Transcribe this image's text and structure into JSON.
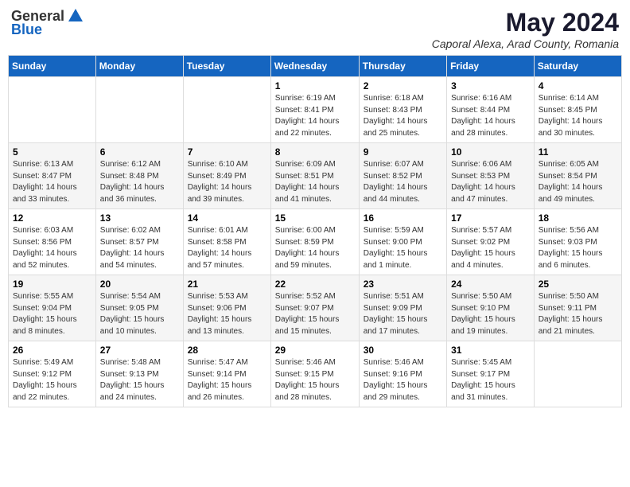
{
  "header": {
    "logo_line1": "General",
    "logo_line2": "Blue",
    "month_title": "May 2024",
    "location": "Caporal Alexa, Arad County, Romania"
  },
  "days_of_week": [
    "Sunday",
    "Monday",
    "Tuesday",
    "Wednesday",
    "Thursday",
    "Friday",
    "Saturday"
  ],
  "weeks": [
    [
      {
        "day": "",
        "info": ""
      },
      {
        "day": "",
        "info": ""
      },
      {
        "day": "",
        "info": ""
      },
      {
        "day": "1",
        "info": "Sunrise: 6:19 AM\nSunset: 8:41 PM\nDaylight: 14 hours\nand 22 minutes."
      },
      {
        "day": "2",
        "info": "Sunrise: 6:18 AM\nSunset: 8:43 PM\nDaylight: 14 hours\nand 25 minutes."
      },
      {
        "day": "3",
        "info": "Sunrise: 6:16 AM\nSunset: 8:44 PM\nDaylight: 14 hours\nand 28 minutes."
      },
      {
        "day": "4",
        "info": "Sunrise: 6:14 AM\nSunset: 8:45 PM\nDaylight: 14 hours\nand 30 minutes."
      }
    ],
    [
      {
        "day": "5",
        "info": "Sunrise: 6:13 AM\nSunset: 8:47 PM\nDaylight: 14 hours\nand 33 minutes."
      },
      {
        "day": "6",
        "info": "Sunrise: 6:12 AM\nSunset: 8:48 PM\nDaylight: 14 hours\nand 36 minutes."
      },
      {
        "day": "7",
        "info": "Sunrise: 6:10 AM\nSunset: 8:49 PM\nDaylight: 14 hours\nand 39 minutes."
      },
      {
        "day": "8",
        "info": "Sunrise: 6:09 AM\nSunset: 8:51 PM\nDaylight: 14 hours\nand 41 minutes."
      },
      {
        "day": "9",
        "info": "Sunrise: 6:07 AM\nSunset: 8:52 PM\nDaylight: 14 hours\nand 44 minutes."
      },
      {
        "day": "10",
        "info": "Sunrise: 6:06 AM\nSunset: 8:53 PM\nDaylight: 14 hours\nand 47 minutes."
      },
      {
        "day": "11",
        "info": "Sunrise: 6:05 AM\nSunset: 8:54 PM\nDaylight: 14 hours\nand 49 minutes."
      }
    ],
    [
      {
        "day": "12",
        "info": "Sunrise: 6:03 AM\nSunset: 8:56 PM\nDaylight: 14 hours\nand 52 minutes."
      },
      {
        "day": "13",
        "info": "Sunrise: 6:02 AM\nSunset: 8:57 PM\nDaylight: 14 hours\nand 54 minutes."
      },
      {
        "day": "14",
        "info": "Sunrise: 6:01 AM\nSunset: 8:58 PM\nDaylight: 14 hours\nand 57 minutes."
      },
      {
        "day": "15",
        "info": "Sunrise: 6:00 AM\nSunset: 8:59 PM\nDaylight: 14 hours\nand 59 minutes."
      },
      {
        "day": "16",
        "info": "Sunrise: 5:59 AM\nSunset: 9:00 PM\nDaylight: 15 hours\nand 1 minute."
      },
      {
        "day": "17",
        "info": "Sunrise: 5:57 AM\nSunset: 9:02 PM\nDaylight: 15 hours\nand 4 minutes."
      },
      {
        "day": "18",
        "info": "Sunrise: 5:56 AM\nSunset: 9:03 PM\nDaylight: 15 hours\nand 6 minutes."
      }
    ],
    [
      {
        "day": "19",
        "info": "Sunrise: 5:55 AM\nSunset: 9:04 PM\nDaylight: 15 hours\nand 8 minutes."
      },
      {
        "day": "20",
        "info": "Sunrise: 5:54 AM\nSunset: 9:05 PM\nDaylight: 15 hours\nand 10 minutes."
      },
      {
        "day": "21",
        "info": "Sunrise: 5:53 AM\nSunset: 9:06 PM\nDaylight: 15 hours\nand 13 minutes."
      },
      {
        "day": "22",
        "info": "Sunrise: 5:52 AM\nSunset: 9:07 PM\nDaylight: 15 hours\nand 15 minutes."
      },
      {
        "day": "23",
        "info": "Sunrise: 5:51 AM\nSunset: 9:09 PM\nDaylight: 15 hours\nand 17 minutes."
      },
      {
        "day": "24",
        "info": "Sunrise: 5:50 AM\nSunset: 9:10 PM\nDaylight: 15 hours\nand 19 minutes."
      },
      {
        "day": "25",
        "info": "Sunrise: 5:50 AM\nSunset: 9:11 PM\nDaylight: 15 hours\nand 21 minutes."
      }
    ],
    [
      {
        "day": "26",
        "info": "Sunrise: 5:49 AM\nSunset: 9:12 PM\nDaylight: 15 hours\nand 22 minutes."
      },
      {
        "day": "27",
        "info": "Sunrise: 5:48 AM\nSunset: 9:13 PM\nDaylight: 15 hours\nand 24 minutes."
      },
      {
        "day": "28",
        "info": "Sunrise: 5:47 AM\nSunset: 9:14 PM\nDaylight: 15 hours\nand 26 minutes."
      },
      {
        "day": "29",
        "info": "Sunrise: 5:46 AM\nSunset: 9:15 PM\nDaylight: 15 hours\nand 28 minutes."
      },
      {
        "day": "30",
        "info": "Sunrise: 5:46 AM\nSunset: 9:16 PM\nDaylight: 15 hours\nand 29 minutes."
      },
      {
        "day": "31",
        "info": "Sunrise: 5:45 AM\nSunset: 9:17 PM\nDaylight: 15 hours\nand 31 minutes."
      },
      {
        "day": "",
        "info": ""
      }
    ]
  ]
}
